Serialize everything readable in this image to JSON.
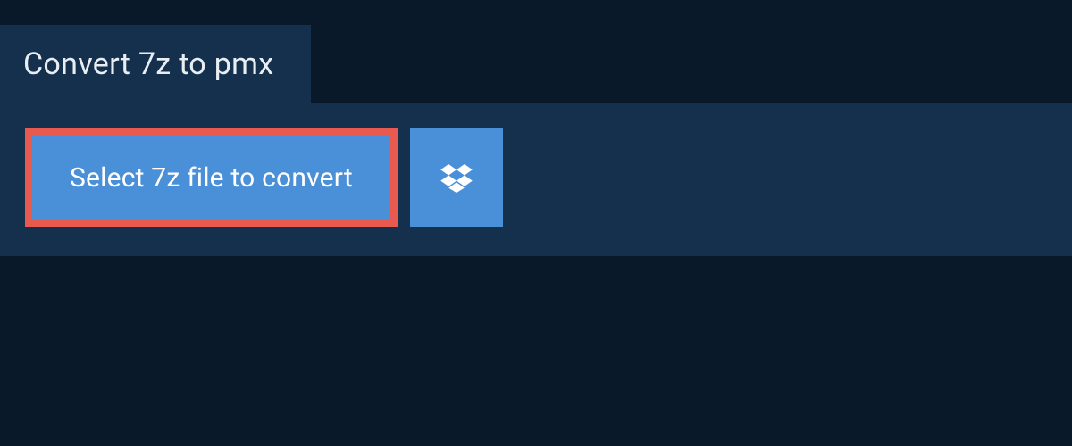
{
  "header": {
    "title": "Convert 7z to pmx"
  },
  "actions": {
    "select_file_label": "Select 7z file to convert",
    "dropbox_icon": "dropbox-icon"
  },
  "colors": {
    "background": "#0a1929",
    "panel": "#14304d",
    "button": "#4a90d9",
    "highlight_border": "#e85a4f",
    "text_light": "#ffffff"
  }
}
